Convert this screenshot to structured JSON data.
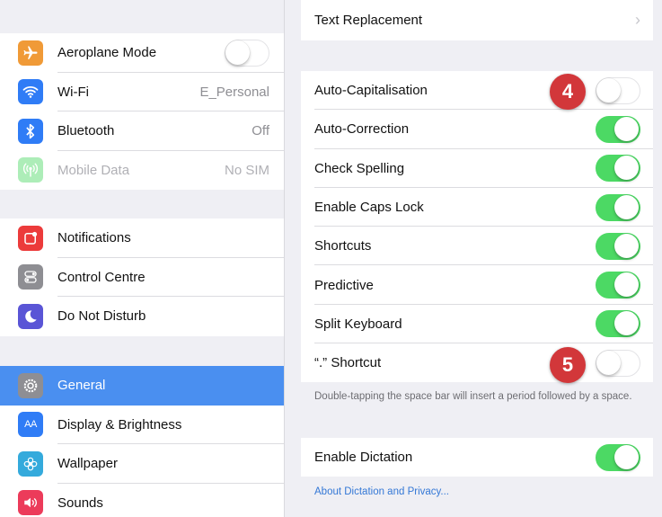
{
  "colors": {
    "selected_row": "#4a8ff0",
    "toggle_on": "#4cd964",
    "badge": "#d2373a",
    "link": "#3478d6"
  },
  "sidebar": {
    "group1": [
      {
        "label": "Aeroplane Mode",
        "icon": "airplane-icon",
        "icon_color": "#f09a37",
        "control": "toggle",
        "toggle_on": false
      },
      {
        "label": "Wi-Fi",
        "icon": "wifi-icon",
        "icon_color": "#2f7cf6",
        "value": "E_Personal"
      },
      {
        "label": "Bluetooth",
        "icon": "bluetooth-icon",
        "icon_color": "#2f7cf6",
        "value": "Off"
      },
      {
        "label": "Mobile Data",
        "icon": "antenna-icon",
        "icon_color": "#4cd964",
        "value": "No SIM",
        "disabled": true
      }
    ],
    "group2": [
      {
        "label": "Notifications",
        "icon": "notifications-icon",
        "icon_color": "#ec3b3b"
      },
      {
        "label": "Control Centre",
        "icon": "control-centre-icon",
        "icon_color": "#8e8e93"
      },
      {
        "label": "Do Not Disturb",
        "icon": "moon-icon",
        "icon_color": "#5a55d6"
      }
    ],
    "group3": [
      {
        "label": "General",
        "icon": "gear-icon",
        "icon_color": "#8e8e93",
        "selected": true
      },
      {
        "label": "Display & Brightness",
        "icon": "display-icon",
        "icon_color": "#2f7cf6",
        "icon_text": "AA"
      },
      {
        "label": "Wallpaper",
        "icon": "flower-icon",
        "icon_color": "#34aadc"
      },
      {
        "label": "Sounds",
        "icon": "speaker-icon",
        "icon_color": "#ec3b5a"
      }
    ]
  },
  "main": {
    "text_replacement": {
      "label": "Text Replacement"
    },
    "keyboard_settings": [
      {
        "label": "Auto-Capitalisation",
        "toggle_on": false
      },
      {
        "label": "Auto-Correction",
        "toggle_on": true
      },
      {
        "label": "Check Spelling",
        "toggle_on": true
      },
      {
        "label": "Enable Caps Lock",
        "toggle_on": true
      },
      {
        "label": "Shortcuts",
        "toggle_on": true
      },
      {
        "label": "Predictive",
        "toggle_on": true
      },
      {
        "label": "Split Keyboard",
        "toggle_on": true
      },
      {
        "label": "“.” Shortcut",
        "toggle_on": false
      }
    ],
    "shortcut_footnote": "Double-tapping the space bar will insert a period followed by a space.",
    "dictation": {
      "label": "Enable Dictation",
      "toggle_on": true
    },
    "dictation_link": "About Dictation and Privacy..."
  },
  "callouts": {
    "badge_4": "4",
    "badge_5": "5"
  }
}
